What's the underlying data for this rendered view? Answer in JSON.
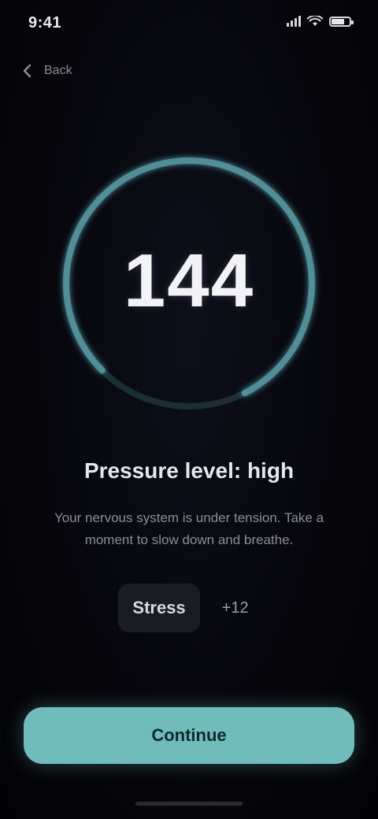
{
  "status_bar": {
    "time": "9:41",
    "battery_level": 0.8,
    "icons": [
      "signal-icon",
      "wifi-icon",
      "battery-icon"
    ]
  },
  "header": {
    "back_icon": "chevron-left-icon",
    "label": "Back"
  },
  "gauge": {
    "value": "144",
    "progress": 0.8,
    "track_color": "#1b2e36",
    "accent_color": "#4f8f95"
  },
  "result": {
    "title": "Pressure level: high",
    "description": "Your nervous system is under tension. Take a moment to slow down and breathe."
  },
  "chips": {
    "primary": "Stress",
    "secondary": "+12"
  },
  "cta": {
    "label": "Continue",
    "color": "#6fbcbb"
  }
}
